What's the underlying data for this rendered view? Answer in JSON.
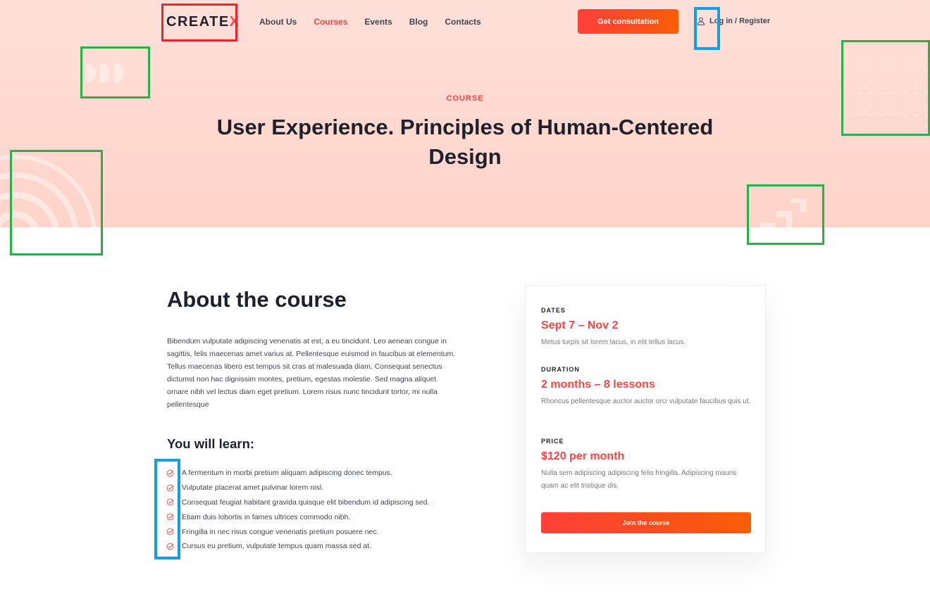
{
  "header": {
    "logo_text": "CREATE",
    "logo_x": "X",
    "nav": [
      {
        "label": "About Us"
      },
      {
        "label": "Courses"
      },
      {
        "label": "Events"
      },
      {
        "label": "Blog"
      },
      {
        "label": "Contacts"
      }
    ],
    "active_nav": "Courses",
    "cta_label": "Get consultation",
    "login_label": "Log in / Register"
  },
  "hero": {
    "eyebrow": "COURSE",
    "title": "User Experience. Principles of Human-Centered Design"
  },
  "about": {
    "heading": "About the course",
    "paragraph": "Bibendum vulputate adipiscing venenatis at est, a eu tincidunt. Leo aenean congue in sagittis, felis maecenas amet varius at. Pellentesque euismod in faucibus at elementum. Tellus maecenas libero est tempus sit cras at malesuada diam. Consequat senectus dictumst non hac dignissim montes, pretium, egestas molestie. Sed magna aliquet ornare nibh vel lectus diam eget pretium. Lorem risus nunc tincidunt tortor, mi nulla pellentesque",
    "learn_heading": "You will learn:",
    "learn_items": [
      "A fermentum in morbi pretium aliquam adipiscing donec tempus.",
      "Vulputate placerat amet pulvinar lorem nisl.",
      "Consequat feugiat habitant gravida quisque elit bibendum id adipiscing sed.",
      "Etiam duis lobortis in fames ultrices commodo nibh.",
      "Fringilla in nec risus congue venenatis pretium posuere nec.",
      "Cursus eu pretium, vulputate tempus quam massa sed at."
    ]
  },
  "card": {
    "dates_label": "DATES",
    "dates_value": "Sept 7 – Nov 2",
    "dates_desc": "Metus turpis sit lorem lacus, in elit tellus lacus.",
    "duration_label": "DURATION",
    "duration_value": "2 months – 8 lessons",
    "duration_desc": "Rhoncus pellentesque auctor auctor orci vulputate faucibus quis ut.",
    "price_label": "PRICE",
    "price_value": "$120 per month",
    "price_desc": "Nulla sem adipiscing adipiscing felis fringilla. Adipiscing mauris quam ac elit tristique dis.",
    "join_label": "Join the course"
  },
  "colors": {
    "accent": "#ff4242",
    "gradient_start": "#ff3f3a",
    "gradient_end": "#f75e05",
    "hero_bg": "#ffd9cf",
    "highlight_red": "#e8262c",
    "highlight_blue": "#0ea0e0",
    "highlight_green": "#2ab04a"
  },
  "icons": {
    "login": "user-icon",
    "learn_item": "check-circle-icon"
  }
}
